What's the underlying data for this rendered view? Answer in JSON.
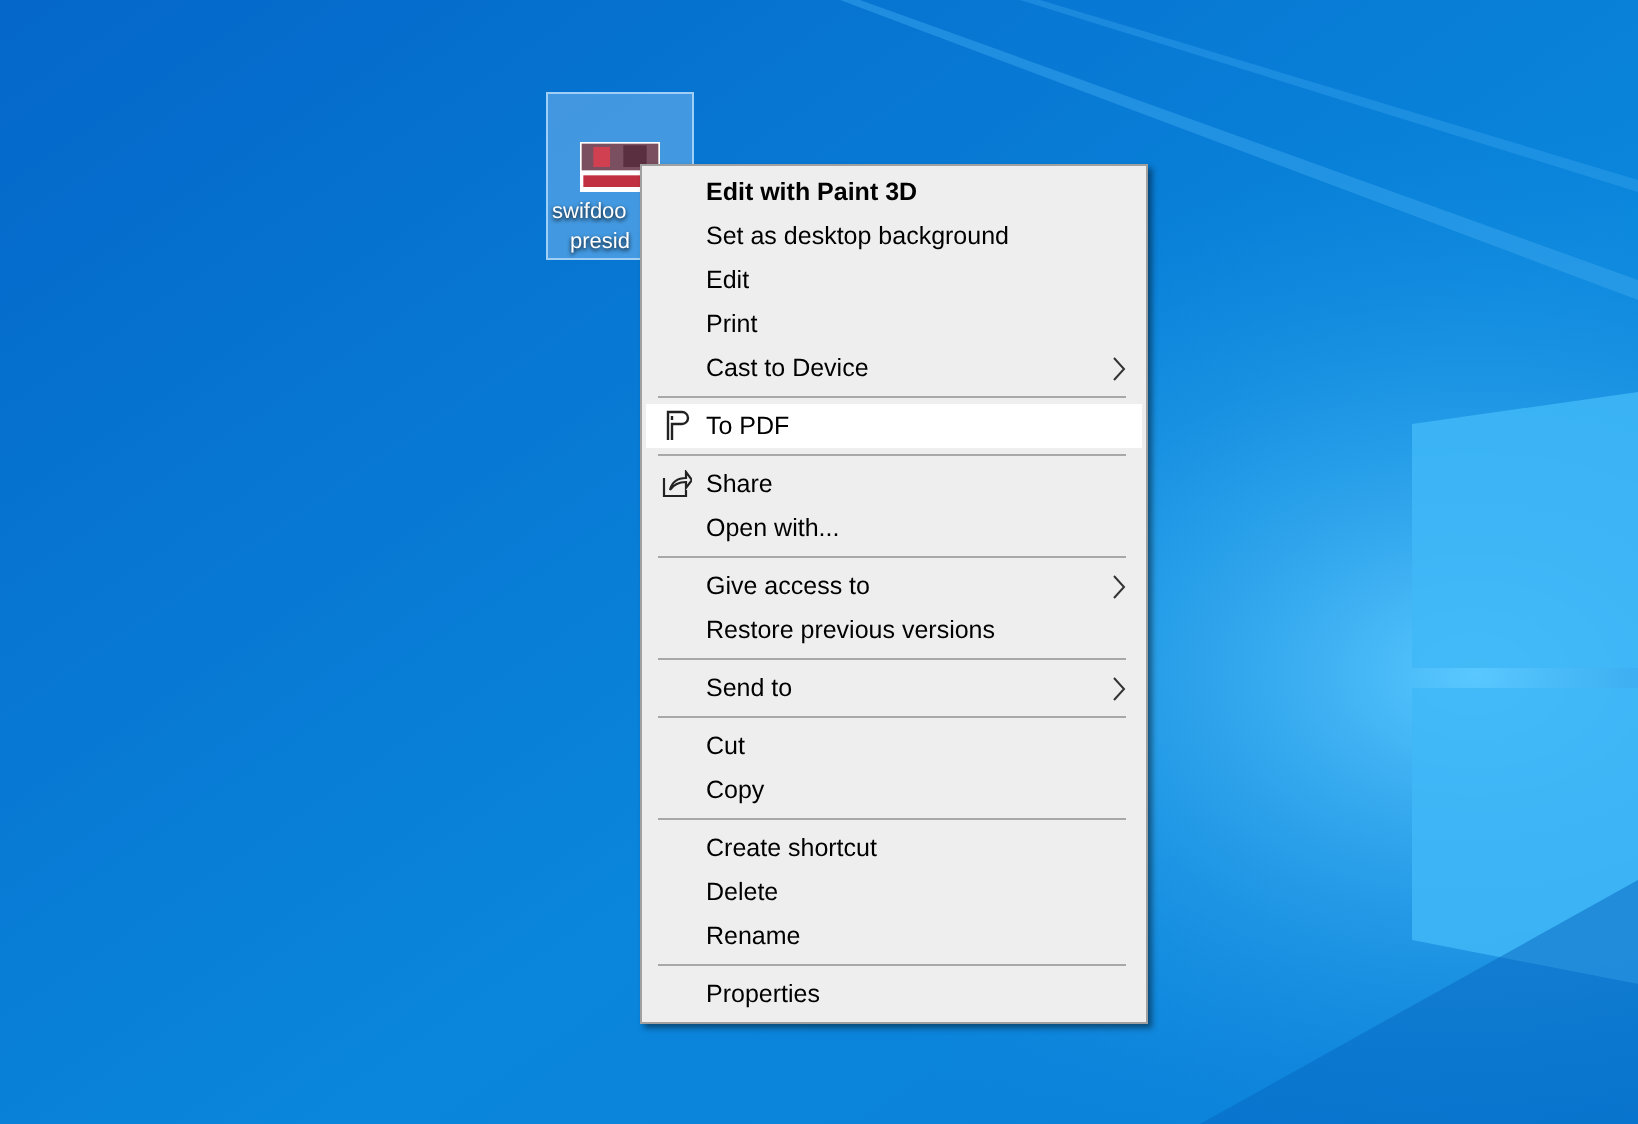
{
  "desktop_icon": {
    "label_lines": [
      "swifdoo",
      "presid"
    ],
    "selected": true
  },
  "context_menu": {
    "groups": [
      {
        "items": [
          {
            "label": "Edit with Paint 3D",
            "default": true,
            "selected": false,
            "submenu": false
          },
          {
            "label": "Set as desktop background",
            "selected": false,
            "submenu": false
          },
          {
            "label": "Edit",
            "selected": false,
            "submenu": false
          },
          {
            "label": "Print",
            "selected": false,
            "submenu": false
          },
          {
            "label": "Cast to Device",
            "selected": false,
            "submenu": true
          }
        ]
      },
      {
        "items": [
          {
            "label": "To PDF",
            "kind": "pdf",
            "selected": true,
            "submenu": false
          }
        ]
      },
      {
        "items": [
          {
            "label": "Share",
            "kind": "share",
            "selected": false,
            "submenu": false
          },
          {
            "label": "Open with...",
            "selected": false,
            "submenu": false
          }
        ]
      },
      {
        "items": [
          {
            "label": "Give access to",
            "selected": false,
            "submenu": true
          },
          {
            "label": "Restore previous versions",
            "selected": false,
            "submenu": false
          }
        ]
      },
      {
        "items": [
          {
            "label": "Send to",
            "selected": false,
            "submenu": true
          }
        ]
      },
      {
        "items": [
          {
            "label": "Cut",
            "selected": false,
            "submenu": false
          },
          {
            "label": "Copy",
            "selected": false,
            "submenu": false
          }
        ]
      },
      {
        "items": [
          {
            "label": "Create shortcut",
            "selected": false,
            "submenu": false
          },
          {
            "label": "Delete",
            "selected": false,
            "submenu": false
          },
          {
            "label": "Rename",
            "selected": false,
            "submenu": false
          }
        ]
      },
      {
        "items": [
          {
            "label": "Properties",
            "selected": false,
            "submenu": false
          }
        ]
      }
    ]
  }
}
